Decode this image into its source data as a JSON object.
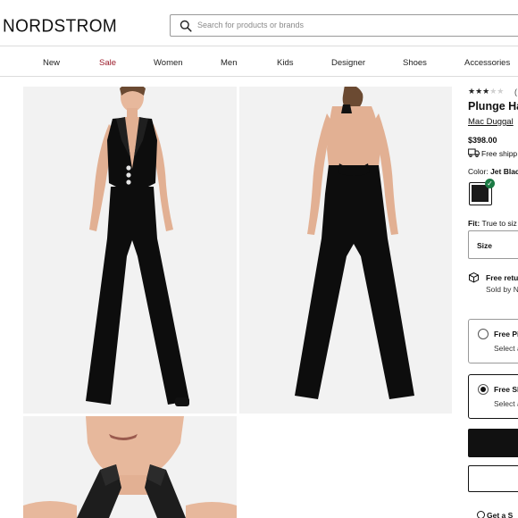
{
  "header": {
    "logo": "NORDSTROM",
    "search_placeholder": "Search for products or brands"
  },
  "nav": {
    "items": [
      "New",
      "Sale",
      "Women",
      "Men",
      "Kids",
      "Designer",
      "Shoes",
      "Accessories"
    ]
  },
  "product": {
    "rating": 3,
    "rating_max": 5,
    "rating_count": "(",
    "title": "Plunge Ha",
    "brand": "Mac Duggal",
    "price": "$398.00",
    "shipping": "Free shipp",
    "color_label": "Color:",
    "color_value": "Jet Blac",
    "fit_label": "Fit:",
    "fit_value": "True to siz",
    "size_label": "Size",
    "returns_title": "Free retu",
    "returns_sub": "Sold by N",
    "options": [
      {
        "title": "Free Pi",
        "sub": "Select a",
        "selected": false
      },
      {
        "title": "Free Sh",
        "sub": "Select a",
        "selected": true
      }
    ],
    "gift_label": "Get a S"
  },
  "colors": {
    "sale": "#9b1b2a",
    "check": "#1b7a44",
    "garment": "#0d0d0d"
  }
}
